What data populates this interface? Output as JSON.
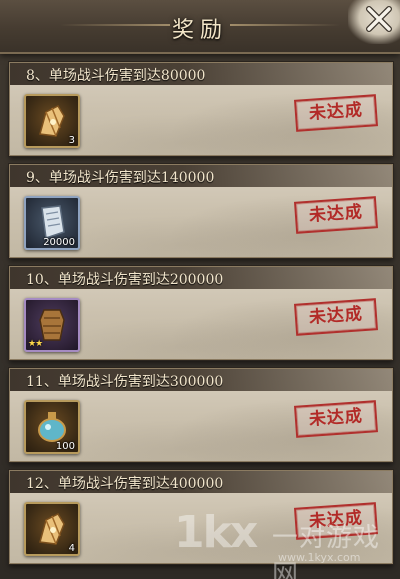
{
  "header": {
    "title": "奖励"
  },
  "rewards": [
    {
      "title": "8、单场战斗伤害到达80000",
      "item_icon": "bracer-icon",
      "count": "3",
      "status": "未达成"
    },
    {
      "title": "9、单场战斗伤害到达140000",
      "item_icon": "scroll-icon",
      "count": "20000",
      "status": "未达成"
    },
    {
      "title": "10、单场战斗伤害到达200000",
      "item_icon": "armor-icon",
      "count": "",
      "stars": "★★",
      "status": "未达成"
    },
    {
      "title": "11、单场战斗伤害到达300000",
      "item_icon": "potion-flask-icon",
      "count": "100",
      "status": "未达成"
    },
    {
      "title": "12、单场战斗伤害到达400000",
      "item_icon": "bracer-icon",
      "count": "4",
      "status": "未达成"
    }
  ],
  "watermark": {
    "logo": "1kx",
    "name": "一对游戏网",
    "url": "www.1kyx.com"
  },
  "colors": {
    "stamp": "#b22a27",
    "header_text": "#f3e6c8",
    "card_bg": "#cbc1ae"
  }
}
